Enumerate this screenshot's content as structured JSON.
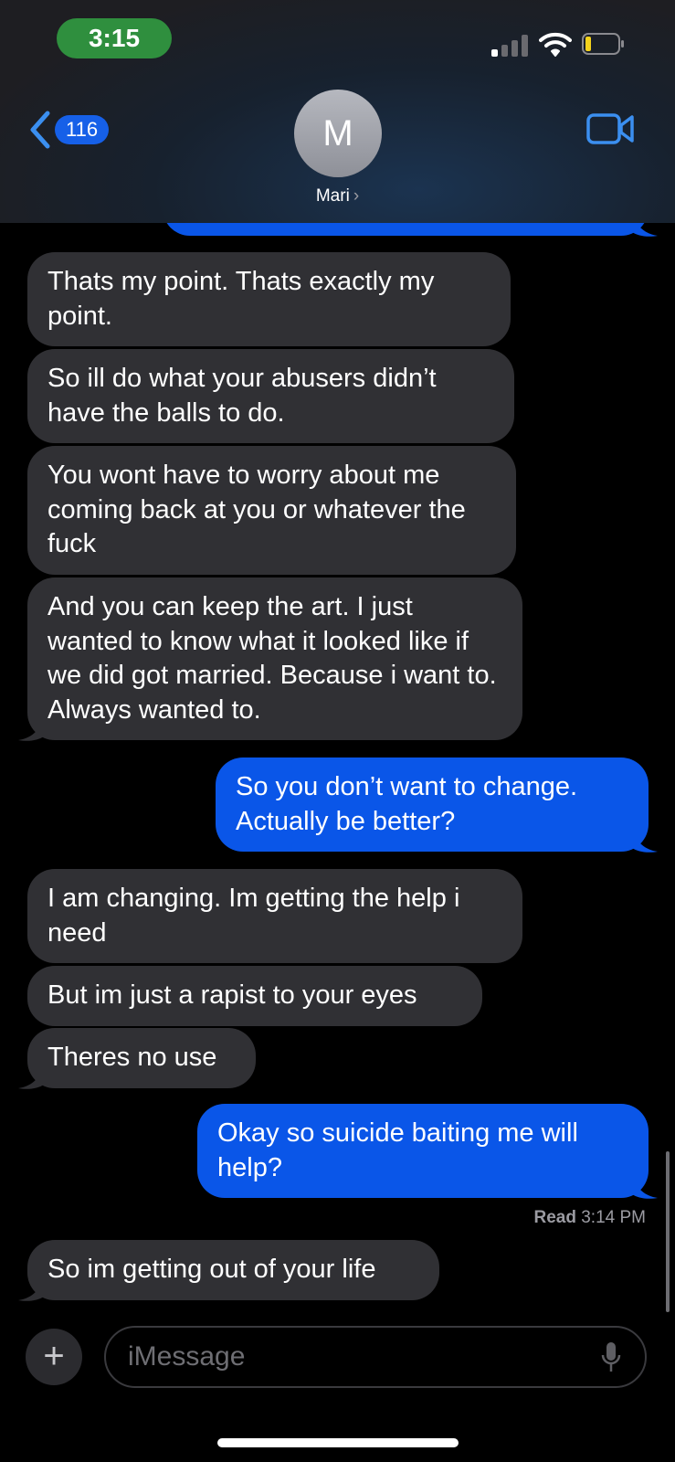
{
  "status_bar": {
    "time": "3:15"
  },
  "nav": {
    "back_count": "116",
    "avatar_initial": "M",
    "contact_name": "Mari",
    "name_chevron": "›"
  },
  "messages": [
    {
      "side": "in",
      "text": "Thats my point. Thats exactly my point."
    },
    {
      "side": "in",
      "text": "So ill do what your abusers didn’t have the balls to do."
    },
    {
      "side": "in",
      "text": "You wont have to worry about me coming back at you or whatever the fuck"
    },
    {
      "side": "in",
      "text": "And you can keep the art. I just wanted to know what it looked like if we did got married. Because i want to. Always wanted to."
    },
    {
      "side": "out",
      "text": "So you don’t want to change. Actually be better?"
    },
    {
      "side": "in",
      "text": "I am changing. Im getting the help i need"
    },
    {
      "side": "in",
      "text": "But im just a rapist to your eyes"
    },
    {
      "side": "in",
      "text": "Theres no use"
    },
    {
      "side": "out",
      "text": "Okay so suicide baiting me will help?"
    },
    {
      "side": "in",
      "text": "So im getting out of your life"
    }
  ],
  "receipt": {
    "label": "Read",
    "time": "3:14 PM"
  },
  "composer": {
    "placeholder": "iMessage",
    "plus": "+"
  },
  "icons": {
    "back": "chevron-left-icon",
    "video": "video-camera-icon",
    "mic": "microphone-icon",
    "signal": "cellular-signal-icon",
    "wifi": "wifi-icon",
    "battery": "battery-icon"
  },
  "colors": {
    "outgoing_bubble": "#0a56e8",
    "incoming_bubble": "#303034",
    "accent": "#3b8ff0",
    "status_pill": "#2f8f3e",
    "battery_level": "#f4d21c"
  }
}
